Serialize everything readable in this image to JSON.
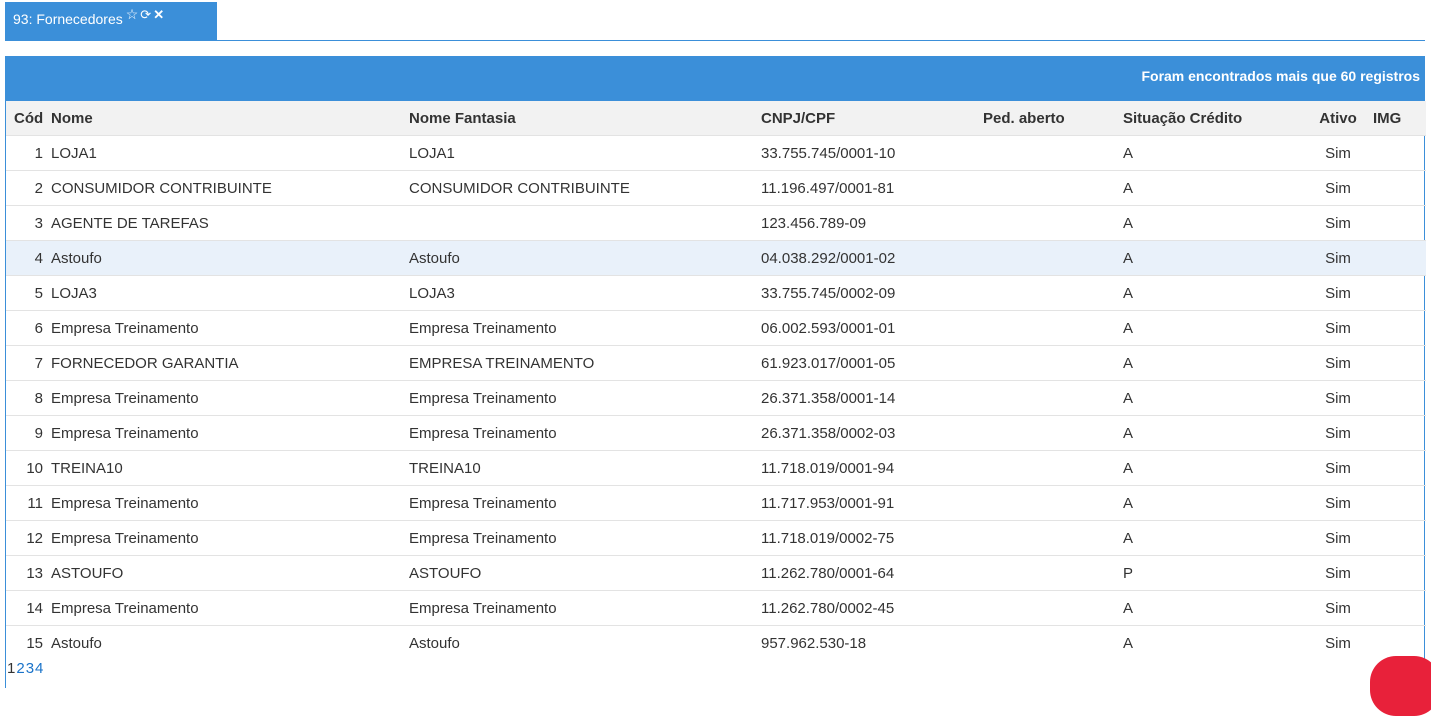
{
  "tab": {
    "label": "93: Fornecedores",
    "icons": [
      "star-icon",
      "refresh-icon",
      "close-icon"
    ]
  },
  "panel": {
    "header_text": "Foram encontrados mais que 60 registros"
  },
  "table": {
    "columns": [
      "Cód",
      "Nome",
      "Nome Fantasia",
      "CNPJ/CPF",
      "Ped. aberto",
      "Situação Crédito",
      "Ativo",
      "IMG"
    ],
    "rows": [
      {
        "cod": "1",
        "nome": "LOJA1",
        "fantasia": "LOJA1",
        "cnpj": "33.755.745/0001-10",
        "ped": "",
        "sit": "A",
        "ativo": "Sim",
        "img": ""
      },
      {
        "cod": "2",
        "nome": "CONSUMIDOR CONTRIBUINTE",
        "fantasia": "CONSUMIDOR CONTRIBUINTE",
        "cnpj": "11.196.497/0001-81",
        "ped": "",
        "sit": "A",
        "ativo": "Sim",
        "img": ""
      },
      {
        "cod": "3",
        "nome": "AGENTE DE TAREFAS",
        "fantasia": "",
        "cnpj": "123.456.789-09",
        "ped": "",
        "sit": "A",
        "ativo": "Sim",
        "img": ""
      },
      {
        "cod": "4",
        "nome": "Astoufo",
        "fantasia": "Astoufo",
        "cnpj": "04.038.292/0001-02",
        "ped": "",
        "sit": "A",
        "ativo": "Sim",
        "img": ""
      },
      {
        "cod": "5",
        "nome": "LOJA3",
        "fantasia": "LOJA3",
        "cnpj": "33.755.745/0002-09",
        "ped": "",
        "sit": "A",
        "ativo": "Sim",
        "img": ""
      },
      {
        "cod": "6",
        "nome": "Empresa Treinamento",
        "fantasia": "Empresa Treinamento",
        "cnpj": "06.002.593/0001-01",
        "ped": "",
        "sit": "A",
        "ativo": "Sim",
        "img": ""
      },
      {
        "cod": "7",
        "nome": "FORNECEDOR GARANTIA",
        "fantasia": "EMPRESA TREINAMENTO",
        "cnpj": "61.923.017/0001-05",
        "ped": "",
        "sit": "A",
        "ativo": "Sim",
        "img": ""
      },
      {
        "cod": "8",
        "nome": "Empresa Treinamento",
        "fantasia": "Empresa Treinamento",
        "cnpj": "26.371.358/0001-14",
        "ped": "",
        "sit": "A",
        "ativo": "Sim",
        "img": ""
      },
      {
        "cod": "9",
        "nome": "Empresa Treinamento",
        "fantasia": "Empresa Treinamento",
        "cnpj": "26.371.358/0002-03",
        "ped": "",
        "sit": "A",
        "ativo": "Sim",
        "img": ""
      },
      {
        "cod": "10",
        "nome": "TREINA10",
        "fantasia": "TREINA10",
        "cnpj": "11.718.019/0001-94",
        "ped": "",
        "sit": "A",
        "ativo": "Sim",
        "img": ""
      },
      {
        "cod": "11",
        "nome": "Empresa Treinamento",
        "fantasia": "Empresa Treinamento",
        "cnpj": "11.717.953/0001-91",
        "ped": "",
        "sit": "A",
        "ativo": "Sim",
        "img": ""
      },
      {
        "cod": "12",
        "nome": "Empresa Treinamento",
        "fantasia": "Empresa Treinamento",
        "cnpj": "11.718.019/0002-75",
        "ped": "",
        "sit": "A",
        "ativo": "Sim",
        "img": ""
      },
      {
        "cod": "13",
        "nome": "ASTOUFO",
        "fantasia": "ASTOUFO",
        "cnpj": "11.262.780/0001-64",
        "ped": "",
        "sit": "P",
        "ativo": "Sim",
        "img": ""
      },
      {
        "cod": "14",
        "nome": "Empresa Treinamento",
        "fantasia": "Empresa Treinamento",
        "cnpj": "11.262.780/0002-45",
        "ped": "",
        "sit": "A",
        "ativo": "Sim",
        "img": ""
      },
      {
        "cod": "15",
        "nome": "Astoufo",
        "fantasia": "Astoufo",
        "cnpj": "957.962.530-18",
        "ped": "",
        "sit": "A",
        "ativo": "Sim",
        "img": ""
      }
    ],
    "selected_row": 3
  },
  "pagination": {
    "current": "1",
    "pages": [
      "2",
      "3",
      "4"
    ]
  },
  "colors": {
    "accent": "#3b8fd9",
    "selected_row": "#e9f1fa",
    "header_bg": "#f2f2f2",
    "chat_bubble": "#e8213a"
  }
}
